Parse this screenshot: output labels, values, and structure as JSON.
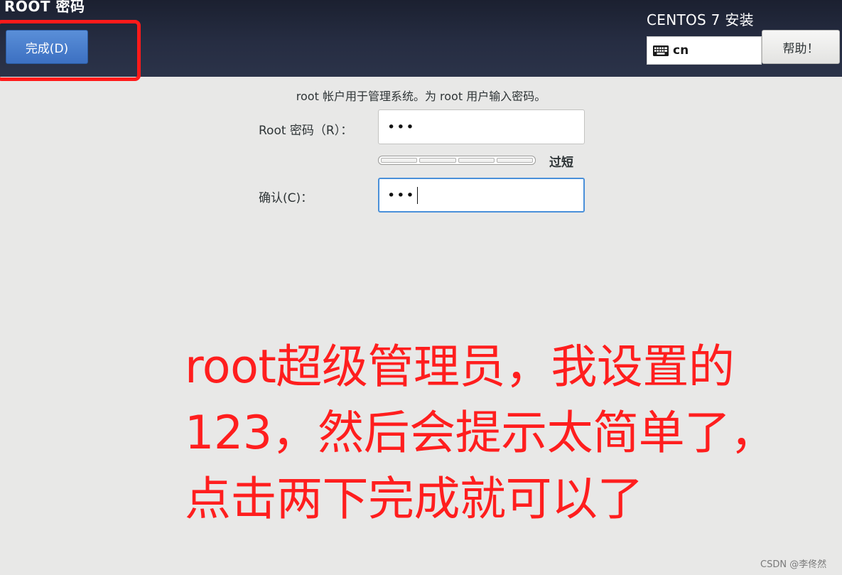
{
  "header": {
    "spoke_title": "ROOT 密码",
    "done_button": "完成(D)",
    "product_title": "CENTOS 7 安装",
    "keyboard": {
      "icon": "keyboard-icon",
      "layout": "cn"
    },
    "help_button": "帮助！"
  },
  "form": {
    "description": "root 帐户用于管理系统。为 root 用户输入密码。",
    "root_password_label": "Root 密码（R）：",
    "root_password_value": "•••",
    "strength": {
      "label": "过短",
      "level": 0,
      "segments": 4
    },
    "confirm_label": "确认(C)：",
    "confirm_value": "•••"
  },
  "annotation": {
    "lines": [
      "root超级管理员，我设置的",
      "123，然后会提示太简单了，",
      "点击两下完成就可以了"
    ],
    "color": "#ff1e1e"
  },
  "watermark": "CSDN @李佟然",
  "colors": {
    "header_bg": "#262d42",
    "done_button": "#3c70c2",
    "focus_border": "#4a90d9",
    "highlight_box": "#ff1a1a"
  }
}
